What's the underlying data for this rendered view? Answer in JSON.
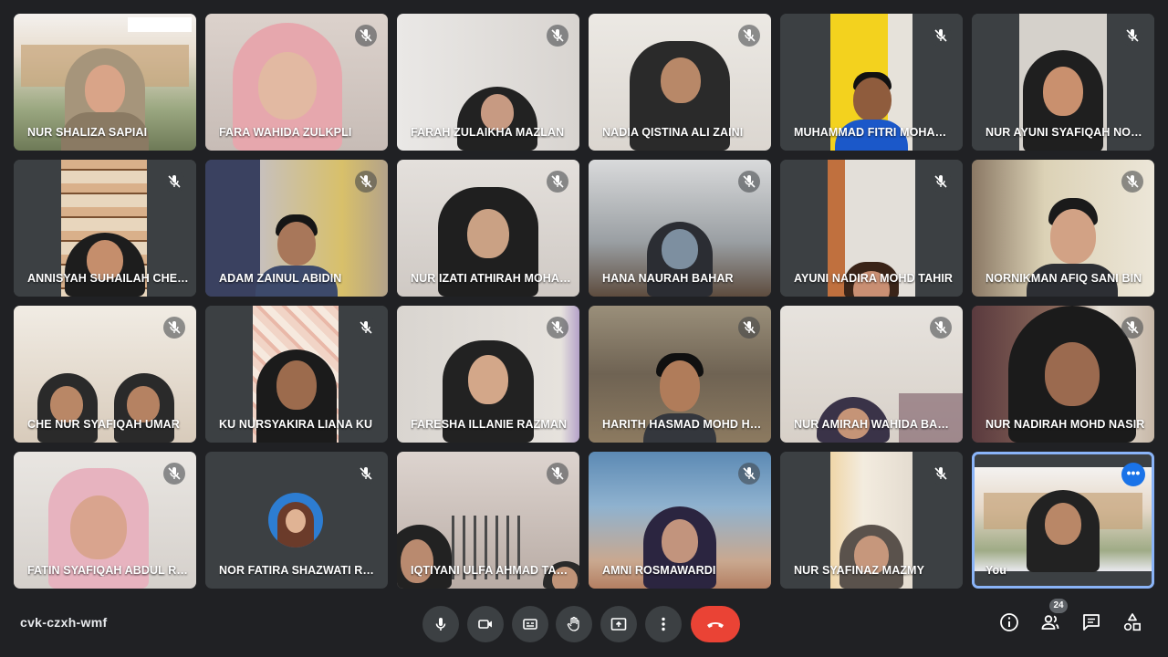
{
  "meeting": {
    "code": "cvk-czxh-wmf",
    "participant_count": "24"
  },
  "participants": [
    {
      "name": "NUR SHALIZA SAPIAI",
      "muted": false
    },
    {
      "name": "FARA WAHIDA ZULKPLI",
      "muted": true
    },
    {
      "name": "FARAH ZULAIKHA MAZLAN",
      "muted": true
    },
    {
      "name": "NADIA QISTINA ALI ZAINI",
      "muted": true
    },
    {
      "name": "MUHAMMAD FITRI MOHAMAD",
      "muted": true
    },
    {
      "name": "NUR AYUNI SYAFIQAH NORDIN",
      "muted": true
    },
    {
      "name": "ANNISYAH SUHAILAH CHE HASSAN",
      "muted": true
    },
    {
      "name": "ADAM ZAINUL ABIDIN",
      "muted": true
    },
    {
      "name": "NUR IZATI ATHIRAH MOHAMAD",
      "muted": true
    },
    {
      "name": "HANA NAURAH BAHAR",
      "muted": true
    },
    {
      "name": "AYUNI NADIRA MOHD TAHIR",
      "muted": true
    },
    {
      "name": "NORNIKMAN AFIQ SANI BIN",
      "muted": true
    },
    {
      "name": "CHE NUR SYAFIQAH UMAR",
      "muted": true
    },
    {
      "name": "KU NURSYAKIRA LIANA KU",
      "muted": true
    },
    {
      "name": "FARESHA ILLANIE RAZMAN",
      "muted": true
    },
    {
      "name": "HARITH HASMAD MOHD HASNI",
      "muted": true
    },
    {
      "name": "NUR AMIRAH WAHIDA BAHARI",
      "muted": true
    },
    {
      "name": "NUR NADIRAH MOHD NASIR",
      "muted": true
    },
    {
      "name": "FATIN SYAFIQAH ABDUL RAHMAN",
      "muted": true
    },
    {
      "name": "NOR FATIRA SHAZWATI ROSLAN",
      "muted": true
    },
    {
      "name": "IQTIYANI ULFA AHMAD TARMIZI",
      "muted": true
    },
    {
      "name": "AMNI ROSMAWARDI",
      "muted": true
    },
    {
      "name": "NUR SYAFINAZ MAZMY",
      "muted": true
    },
    {
      "name": "You",
      "muted": false
    }
  ],
  "controls": {
    "mic": "mic-icon",
    "camera": "camera-icon",
    "captions": "captions-icon",
    "raise_hand": "hand-icon",
    "present": "present-icon",
    "more": "more-vert-icon",
    "end_call": "end-call-icon",
    "info": "info-icon",
    "people": "people-icon",
    "chat": "chat-icon",
    "activities": "activities-icon"
  },
  "colors": {
    "background": "#202124",
    "control_bg": "#3c4043",
    "end_call": "#ea4335",
    "self_border": "#8ab4f8",
    "more_button": "#1a73e8"
  }
}
